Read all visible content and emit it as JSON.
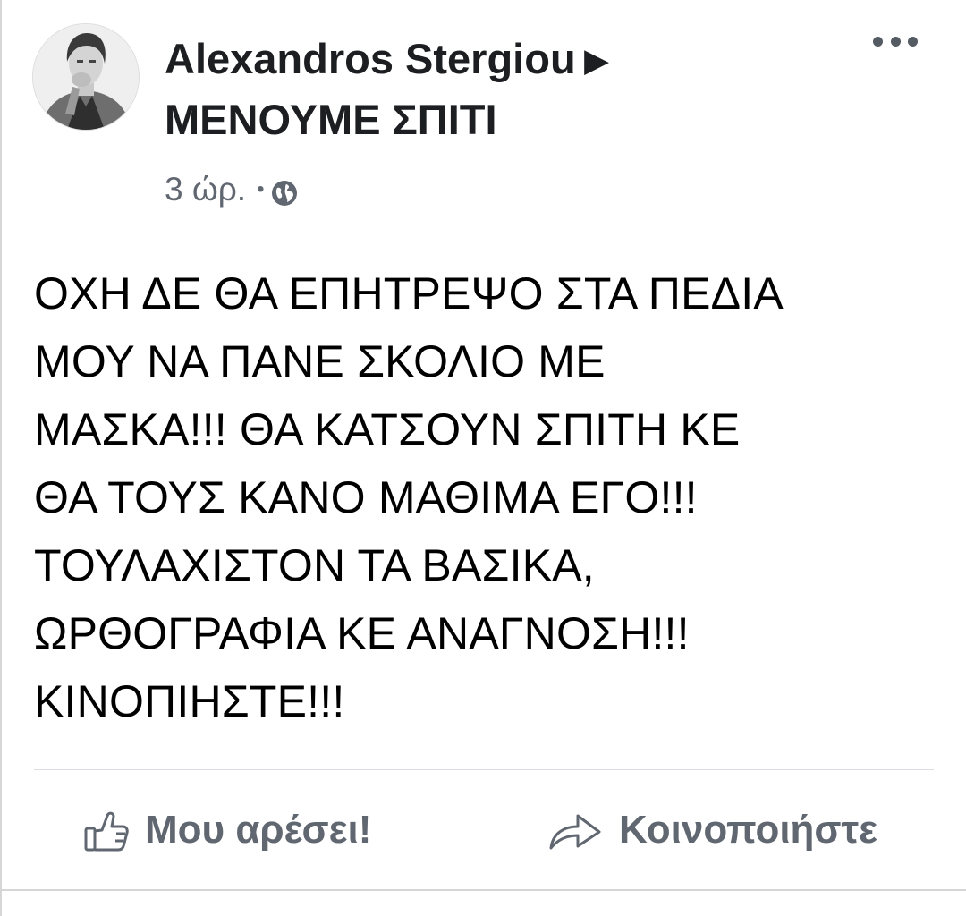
{
  "post": {
    "author": "Alexandros Stergiou",
    "group": "ΜΕΝΟΥΜΕ ΣΠΙΤΙ",
    "timestamp": "3 ώρ.",
    "separator": "•",
    "privacy_icon": "globe-icon",
    "more_icon": "more-options-icon",
    "arrow_icon": "right-triangle-icon",
    "text_lines": [
      "ΟΧΗ ΔΕ ΘΑ ΕΠΗΤΡΕΨΟ ΣΤΑ ΠΕΔΙΑ",
      "ΜΟΥ ΝΑ ΠΑΝΕ ΣΚΟΛΙΟ ΜΕ",
      "ΜΑΣΚΑ!!! ΘΑ ΚΑΤΣΟΥΝ ΣΠΙΤΗ ΚΕ",
      "ΘΑ ΤΟΥΣ ΚΑΝΟ ΜΑΘΙΜΑ ΕΓΟ!!!",
      "ΤΟΥΛΑΧΙΣΤΟΝ ΤΑ ΒΑΣΙΚΑ,",
      "ΩΡΘΟΓΡΑΦΙΑ ΚΕ ΑΝΑΓΝΟΣΗ!!!",
      "ΚΙΝΟΠΙΗΣΤΕ!!!"
    ]
  },
  "actions": {
    "like_label": "Μου αρέσει!",
    "like_icon": "thumbs-up-icon",
    "share_label": "Κοινοποιήστε",
    "share_icon": "share-arrow-icon"
  },
  "colors": {
    "text_primary": "#1c1e21",
    "text_secondary": "#616770",
    "action_gray": "#606770",
    "divider": "#dadde1"
  }
}
